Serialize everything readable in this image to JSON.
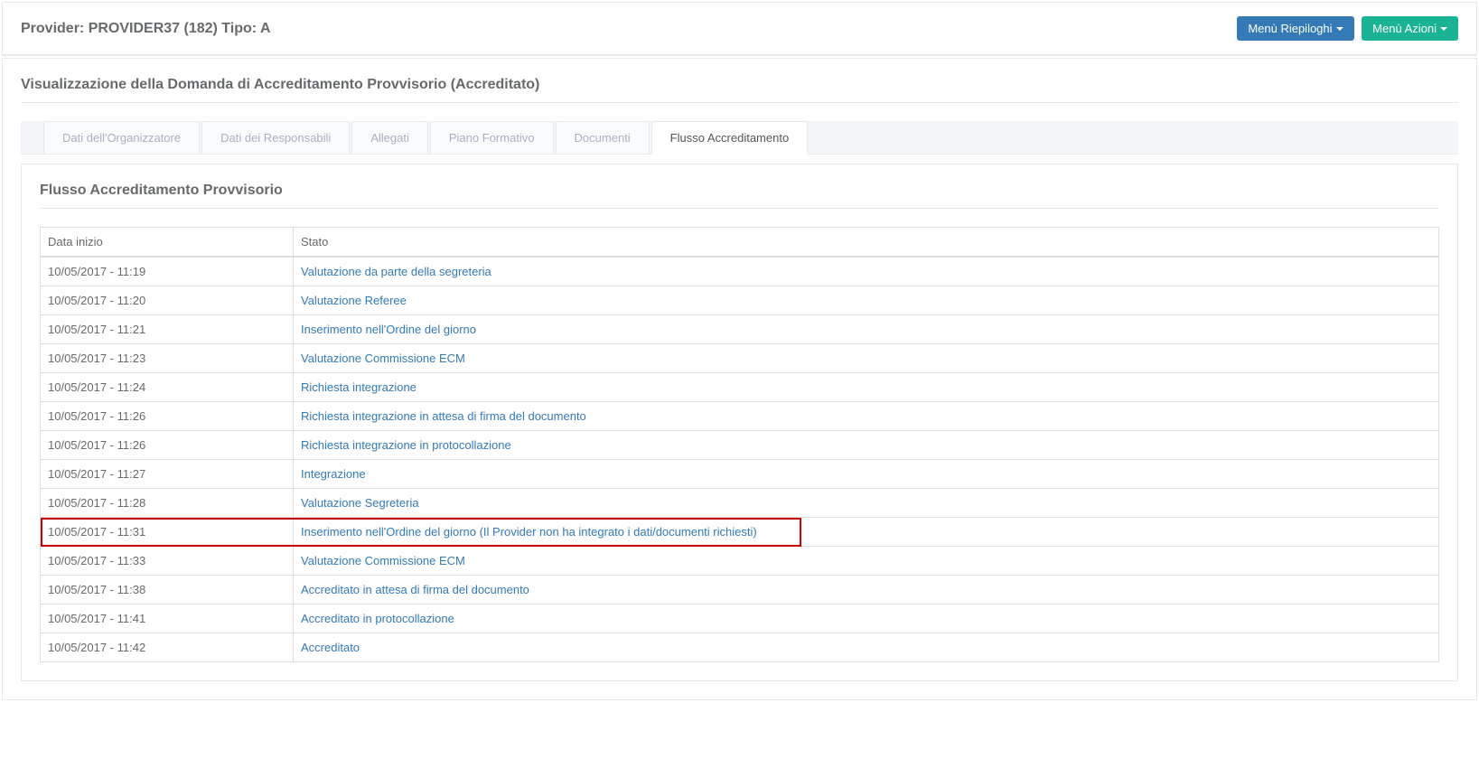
{
  "header": {
    "title": "Provider: PROVIDER37 (182) Tipo: A",
    "menu_riepiloghi_label": "Menù Riepiloghi",
    "menu_azioni_label": "Menù Azioni"
  },
  "page": {
    "section_title": "Visualizzazione della Domanda di Accreditamento Provvisorio (Accreditato)"
  },
  "tabs": [
    {
      "label": "Dati dell'Organizzatore",
      "active": false
    },
    {
      "label": "Dati dei Responsabili",
      "active": false
    },
    {
      "label": "Allegati",
      "active": false
    },
    {
      "label": "Piano Formativo",
      "active": false
    },
    {
      "label": "Documenti",
      "active": false
    },
    {
      "label": "Flusso Accreditamento",
      "active": true
    }
  ],
  "content": {
    "subheading": "Flusso Accreditamento Provvisorio",
    "table": {
      "header_date": "Data inizio",
      "header_state": "Stato",
      "rows": [
        {
          "date": "10/05/2017 - 11:19",
          "state": "Valutazione da parte della segreteria",
          "highlight": false
        },
        {
          "date": "10/05/2017 - 11:20",
          "state": "Valutazione Referee",
          "highlight": false
        },
        {
          "date": "10/05/2017 - 11:21",
          "state": "Inserimento nell'Ordine del giorno",
          "highlight": false
        },
        {
          "date": "10/05/2017 - 11:23",
          "state": "Valutazione Commissione ECM",
          "highlight": false
        },
        {
          "date": "10/05/2017 - 11:24",
          "state": "Richiesta integrazione",
          "highlight": false
        },
        {
          "date": "10/05/2017 - 11:26",
          "state": "Richiesta integrazione in attesa di firma del documento",
          "highlight": false
        },
        {
          "date": "10/05/2017 - 11:26",
          "state": "Richiesta integrazione in protocollazione",
          "highlight": false
        },
        {
          "date": "10/05/2017 - 11:27",
          "state": "Integrazione",
          "highlight": false
        },
        {
          "date": "10/05/2017 - 11:28",
          "state": "Valutazione Segreteria",
          "highlight": false
        },
        {
          "date": "10/05/2017 - 11:31",
          "state": "Inserimento nell'Ordine del giorno (Il Provider non ha integrato i dati/documenti richiesti)",
          "highlight": true
        },
        {
          "date": "10/05/2017 - 11:33",
          "state": "Valutazione Commissione ECM",
          "highlight": false
        },
        {
          "date": "10/05/2017 - 11:38",
          "state": "Accreditato in attesa di firma del documento",
          "highlight": false
        },
        {
          "date": "10/05/2017 - 11:41",
          "state": "Accreditato in protocollazione",
          "highlight": false
        },
        {
          "date": "10/05/2017 - 11:42",
          "state": "Accreditato",
          "highlight": false
        }
      ]
    }
  }
}
